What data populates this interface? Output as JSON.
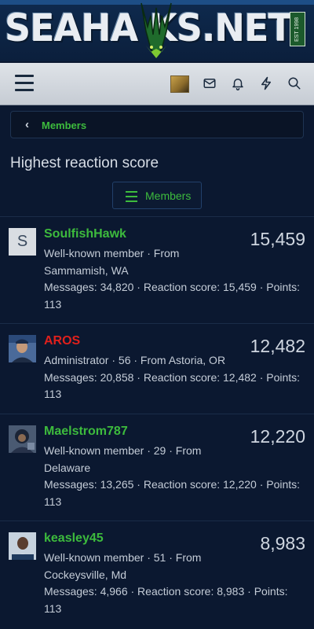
{
  "banner": {
    "logo_text": "SEAHA    KS.NET",
    "est_text": "EST 1998"
  },
  "navbar": {
    "icons": [
      "menu-icon",
      "avatar",
      "mail-icon",
      "bell-icon",
      "bolt-icon",
      "search-icon"
    ]
  },
  "breadcrumb": {
    "label": "Members"
  },
  "page": {
    "title": "Highest reaction score",
    "members_button": "Members"
  },
  "colors": {
    "accent_green": "#3dbb3d",
    "admin_red": "#e0201c",
    "background": "#0b1830"
  },
  "members": [
    {
      "name": "SoulfishHawk",
      "name_color": "#3dbb3d",
      "avatar_letter": "S",
      "score": "15,459",
      "line1": "Well-known member · From",
      "line2": "Sammamish, WA",
      "line3": "Messages: 34,820 · Reaction score: 15,459 · Points:",
      "line4": "113"
    },
    {
      "name": "AROS",
      "name_color": "#e0201c",
      "avatar_letter": "",
      "score": "12,482",
      "line1": "Administrator · 56 · From Astoria, OR",
      "line2": "",
      "line3": "Messages: 20,858 · Reaction score: 12,482 · Points:",
      "line4": "113"
    },
    {
      "name": "Maelstrom787",
      "name_color": "#3dbb3d",
      "avatar_letter": "",
      "score": "12,220",
      "line1": "Well-known member · 29 · From",
      "line2": "Delaware",
      "line3": "Messages: 13,265 · Reaction score: 12,220 · Points:",
      "line4": "113"
    },
    {
      "name": "keasley45",
      "name_color": "#3dbb3d",
      "avatar_letter": "",
      "score": "8,983",
      "line1": "Well-known member · 51 · From",
      "line2": "Cockeysville, Md",
      "line3": "Messages: 4,966 · Reaction score: 8,983 · Points:",
      "line4": "113"
    }
  ]
}
